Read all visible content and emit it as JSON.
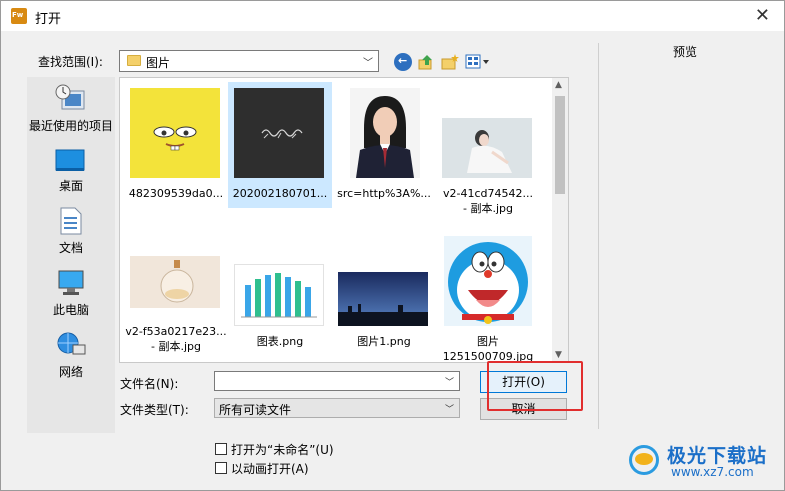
{
  "window": {
    "title": "打开",
    "app_badge": "Fw"
  },
  "look_in": {
    "label": "查找范围(I):",
    "value": "图片"
  },
  "toolbar": {
    "icons": [
      "back-icon",
      "up-folder-icon",
      "new-folder-icon",
      "view-menu-icon"
    ]
  },
  "places": [
    {
      "label": "最近使用的项目",
      "icon": "recent-icon"
    },
    {
      "label": "桌面",
      "icon": "desktop-icon"
    },
    {
      "label": "文档",
      "icon": "documents-icon"
    },
    {
      "label": "此电脑",
      "icon": "computer-icon"
    },
    {
      "label": "网络",
      "icon": "network-icon"
    }
  ],
  "files": [
    {
      "line1": "482309539da0...",
      "line2": "",
      "thumb": "spongebob-yellow"
    },
    {
      "line1": "202002180701...",
      "line2": "",
      "thumb": "dark-calligraphy",
      "selected": true
    },
    {
      "line1": "src=http%3A%...",
      "line2": "",
      "thumb": "portrait"
    },
    {
      "line1": "v2-41cd74542...",
      "line2": "- 副本.jpg",
      "thumb": "woman-photo"
    },
    {
      "line1": "v2-f53a0217e23...",
      "line2": "- 副本.jpg",
      "thumb": "glass-bottle"
    },
    {
      "line1": "图表.png",
      "line2": "",
      "thumb": "bar-chart"
    },
    {
      "line1": "图片1.png",
      "line2": "",
      "thumb": "night-sky"
    },
    {
      "line1": "图片",
      "line2": "1251500709.jpg",
      "thumb": "doraemon"
    }
  ],
  "filename": {
    "label": "文件名(N):",
    "value": ""
  },
  "filetype": {
    "label": "文件类型(T):",
    "value": "所有可读文件"
  },
  "buttons": {
    "open": "打开(O)",
    "cancel": "取消"
  },
  "options": {
    "open_untitled": "打开为“未命名”(U)",
    "open_animation": "以动画打开(A)"
  },
  "preview": {
    "label": "预览"
  },
  "watermark": {
    "title": "极光下载站",
    "url": "www.xz7.com"
  },
  "colors": {
    "accent": "#0078d7",
    "highlight": "#e12e2e",
    "selection": "#cce8ff"
  }
}
